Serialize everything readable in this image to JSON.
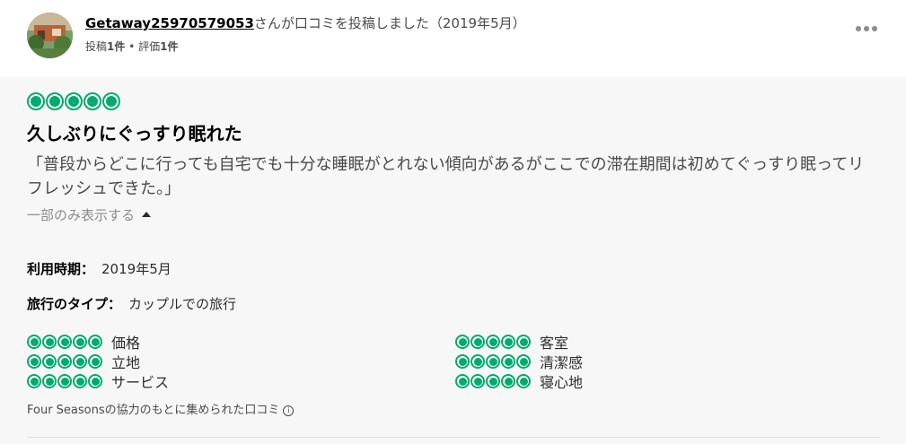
{
  "header": {
    "username": "Getaway25970579053",
    "posted_text": "さんが口コミを投稿しました（2019年5月）",
    "stats_posts_label": "投稿",
    "stats_posts_count": "1件",
    "stats_sep": " • ",
    "stats_reviews_label": "評価",
    "stats_reviews_count": "1件"
  },
  "review": {
    "rating": 5,
    "title": "久しぶりにぐっすり眠れた",
    "text": "「普段からどこに行っても自宅でも十分な睡眠がとれない傾向があるがここでの滞在期間は初めてぐっすり眠ってリフレッシュできた。」",
    "toggle_label": "一部のみ表示する",
    "date_label": "利用時期：",
    "date_value": "2019年5月",
    "trip_type_label": "旅行のタイプ：",
    "trip_type_value": "カップルでの旅行",
    "sub_ratings": [
      {
        "label": "価格",
        "rating": 5
      },
      {
        "label": "立地",
        "rating": 5
      },
      {
        "label": "サービス",
        "rating": 5
      },
      {
        "label": "客室",
        "rating": 5
      },
      {
        "label": "清潔感",
        "rating": 5
      },
      {
        "label": "寝心地",
        "rating": 5
      }
    ],
    "footer_note": "Four Seasonsの協力のもとに集められた口コミ",
    "info_icon": "i"
  },
  "colors": {
    "accent": "#00aa6c",
    "card_bg": "#f7f7f7"
  }
}
